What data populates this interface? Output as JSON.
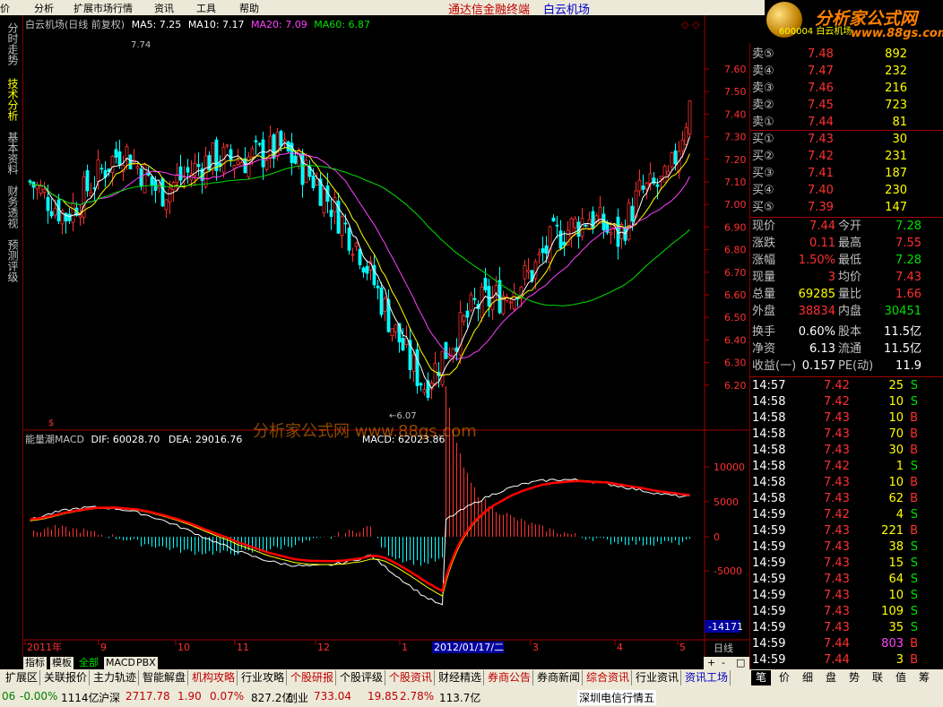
{
  "menu": [
    "价",
    "分析",
    "扩展市场行情",
    "资讯",
    "工具",
    "帮助"
  ],
  "title": {
    "financial": "通达信金融终端",
    "stock": "白云机场"
  },
  "logo": {
    "line1": "分析家公式网",
    "line2": "www.88gs.com",
    "badge": "600004 白云机场"
  },
  "left_tabs": [
    "分时走势",
    "技术分析",
    "基本资料",
    "财务透视",
    "预测评级"
  ],
  "kline": {
    "legend": {
      "name": "白云机场(日线 前复权)",
      "ma5": "MA5: 7.25",
      "ma10": "MA10: 7.17",
      "ma20": "MA20: 7.09",
      "ma60": "MA60: 6.87"
    },
    "yticks": [
      "7.60",
      "7.50",
      "7.40",
      "7.30",
      "7.20",
      "7.10",
      "7.00",
      "6.90",
      "6.80",
      "6.70",
      "6.60",
      "6.50",
      "6.40",
      "6.30",
      "6.20"
    ],
    "high_label": "7.74",
    "low_label": "6.07",
    "low_marker": "←6.07"
  },
  "macd": {
    "legend": {
      "name": "能量潮MACD",
      "dif": "DIF: 60028.70",
      "dea": "DEA: 29016.76",
      "macd": "MACD: 62023.86"
    },
    "watermark": "分析家公式网 www.88gs.com",
    "yticks": [
      "10000",
      "5000",
      "0",
      "-5000"
    ],
    "cursor_value": "-14171"
  },
  "time_axis": {
    "labels": [
      "2011年",
      "9",
      "10",
      "11",
      "12",
      "1",
      "3",
      "4",
      "5"
    ],
    "cursor": "2012/01/17/二",
    "period": "日线"
  },
  "orderbook": {
    "asks": [
      {
        "label": "卖⑤",
        "price": "7.48",
        "vol": "892"
      },
      {
        "label": "卖④",
        "price": "7.47",
        "vol": "232"
      },
      {
        "label": "卖③",
        "price": "7.46",
        "vol": "216"
      },
      {
        "label": "卖②",
        "price": "7.45",
        "vol": "723"
      },
      {
        "label": "卖①",
        "price": "7.44",
        "vol": "81"
      }
    ],
    "bids": [
      {
        "label": "买①",
        "price": "7.43",
        "vol": "30"
      },
      {
        "label": "买②",
        "price": "7.42",
        "vol": "231"
      },
      {
        "label": "买③",
        "price": "7.41",
        "vol": "187"
      },
      {
        "label": "买④",
        "price": "7.40",
        "vol": "230"
      },
      {
        "label": "买⑤",
        "price": "7.39",
        "vol": "147"
      }
    ]
  },
  "quote": [
    {
      "l1": "现价",
      "v1": "7.44",
      "c1": "r",
      "l2": "今开",
      "v2": "7.28",
      "c2": "g"
    },
    {
      "l1": "涨跌",
      "v1": "0.11",
      "c1": "r",
      "l2": "最高",
      "v2": "7.55",
      "c2": "r"
    },
    {
      "l1": "涨幅",
      "v1": "1.50%",
      "c1": "r",
      "l2": "最低",
      "v2": "7.28",
      "c2": "g"
    },
    {
      "l1": "现量",
      "v1": "3",
      "c1": "r",
      "l2": "均价",
      "v2": "7.43",
      "c2": "r"
    },
    {
      "l1": "总量",
      "v1": "69285",
      "c1": "y",
      "l2": "量比",
      "v2": "1.66",
      "c2": "r"
    },
    {
      "l1": "外盘",
      "v1": "38834",
      "c1": "r",
      "l2": "内盘",
      "v2": "30451",
      "c2": "g"
    },
    {
      "l1": "换手",
      "v1": "0.60%",
      "c1": "w",
      "l2": "股本",
      "v2": "11.5亿",
      "c2": "w"
    },
    {
      "l1": "净资",
      "v1": "6.13",
      "c1": "w",
      "l2": "流通",
      "v2": "11.5亿",
      "c2": "w"
    },
    {
      "l1": "收益(一)",
      "v1": "0.157",
      "c1": "w",
      "l2": "PE(动)",
      "v2": "11.9",
      "c2": "w"
    }
  ],
  "ticks": [
    {
      "t": "14:57",
      "p": "7.42",
      "v": "25",
      "s": "S"
    },
    {
      "t": "14:58",
      "p": "7.42",
      "v": "10",
      "s": "S"
    },
    {
      "t": "14:58",
      "p": "7.43",
      "v": "10",
      "s": "B"
    },
    {
      "t": "14:58",
      "p": "7.43",
      "v": "70",
      "s": "B"
    },
    {
      "t": "14:58",
      "p": "7.43",
      "v": "30",
      "s": "B"
    },
    {
      "t": "14:58",
      "p": "7.42",
      "v": "1",
      "s": "S"
    },
    {
      "t": "14:58",
      "p": "7.43",
      "v": "10",
      "s": "B"
    },
    {
      "t": "14:58",
      "p": "7.43",
      "v": "62",
      "s": "B"
    },
    {
      "t": "14:59",
      "p": "7.42",
      "v": "4",
      "s": "S"
    },
    {
      "t": "14:59",
      "p": "7.43",
      "v": "221",
      "s": "B"
    },
    {
      "t": "14:59",
      "p": "7.43",
      "v": "38",
      "s": "S"
    },
    {
      "t": "14:59",
      "p": "7.43",
      "v": "15",
      "s": "S"
    },
    {
      "t": "14:59",
      "p": "7.43",
      "v": "64",
      "s": "S"
    },
    {
      "t": "14:59",
      "p": "7.43",
      "v": "10",
      "s": "S"
    },
    {
      "t": "14:59",
      "p": "7.43",
      "v": "109",
      "s": "S"
    },
    {
      "t": "14:59",
      "p": "7.43",
      "v": "35",
      "s": "S"
    },
    {
      "t": "14:59",
      "p": "7.44",
      "v": "803",
      "s": "B"
    },
    {
      "t": "14:59",
      "p": "7.44",
      "v": "3",
      "s": "B"
    }
  ],
  "bottom_tabs": [
    "指标",
    "模板",
    "全部",
    "MACD",
    "PBX"
  ],
  "nav": [
    "扩展区",
    "关联报价",
    "主力轨迹",
    "智能解盘",
    "机构攻略",
    "行业攻略",
    "个股研报",
    "个股评级",
    "个股资讯",
    "财经精选",
    "券商公告",
    "券商新闻",
    "综合资讯",
    "行业资讯",
    "资讯工场"
  ],
  "rnav": [
    "笔",
    "价",
    "细",
    "盘",
    "势",
    "联",
    "值",
    "筹"
  ],
  "status": {
    "s1": "06",
    "s2": "-0.00%",
    "s3": "1114亿",
    "s4": "沪深",
    "s5": "2717.78",
    "s6": "1.90",
    "s7": "0.07%",
    "s8": "827.2亿",
    "s9": "创业",
    "s10": "733.04",
    "s11": "19.85",
    "s12": "2.78%",
    "s13": "113.7亿",
    "s14": "深圳电信行情五"
  },
  "colors": {
    "up": "#ff3030",
    "down": "#00ffff",
    "ma5": "#ffffff",
    "ma10": "#ffff00",
    "ma20": "#ff40ff",
    "ma60": "#00e000",
    "dif": "#ffffff",
    "dea": "#ffff00",
    "obv": "#ff0000"
  }
}
